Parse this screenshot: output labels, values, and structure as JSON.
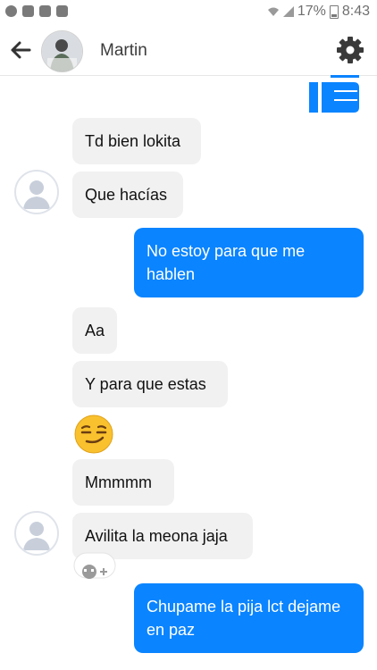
{
  "statusbar": {
    "battery": "17%",
    "time": "8:43"
  },
  "header": {
    "contact_name": "Martin"
  },
  "messages": [
    {
      "from": "them",
      "text": "Td bien lokita"
    },
    {
      "from": "them",
      "text": "Que hacías"
    },
    {
      "from": "me",
      "text": "No estoy para que me hablen"
    },
    {
      "from": "them",
      "text": "Aa"
    },
    {
      "from": "them",
      "text": "Y para que estas"
    },
    {
      "from": "them",
      "text": "Mmmmm"
    },
    {
      "from": "them",
      "text": "Avilita la meona jaja"
    },
    {
      "from": "me",
      "text": "Chupame la pija lct dejame en paz"
    }
  ],
  "colors": {
    "accent": "#0a84ff",
    "incoming_bubble": "#f1f1f1"
  },
  "icons": [
    "back-arrow-icon",
    "settings-gear-icon",
    "thumbs-up-icon",
    "smirk-emoji-icon",
    "add-reaction-icon"
  ]
}
